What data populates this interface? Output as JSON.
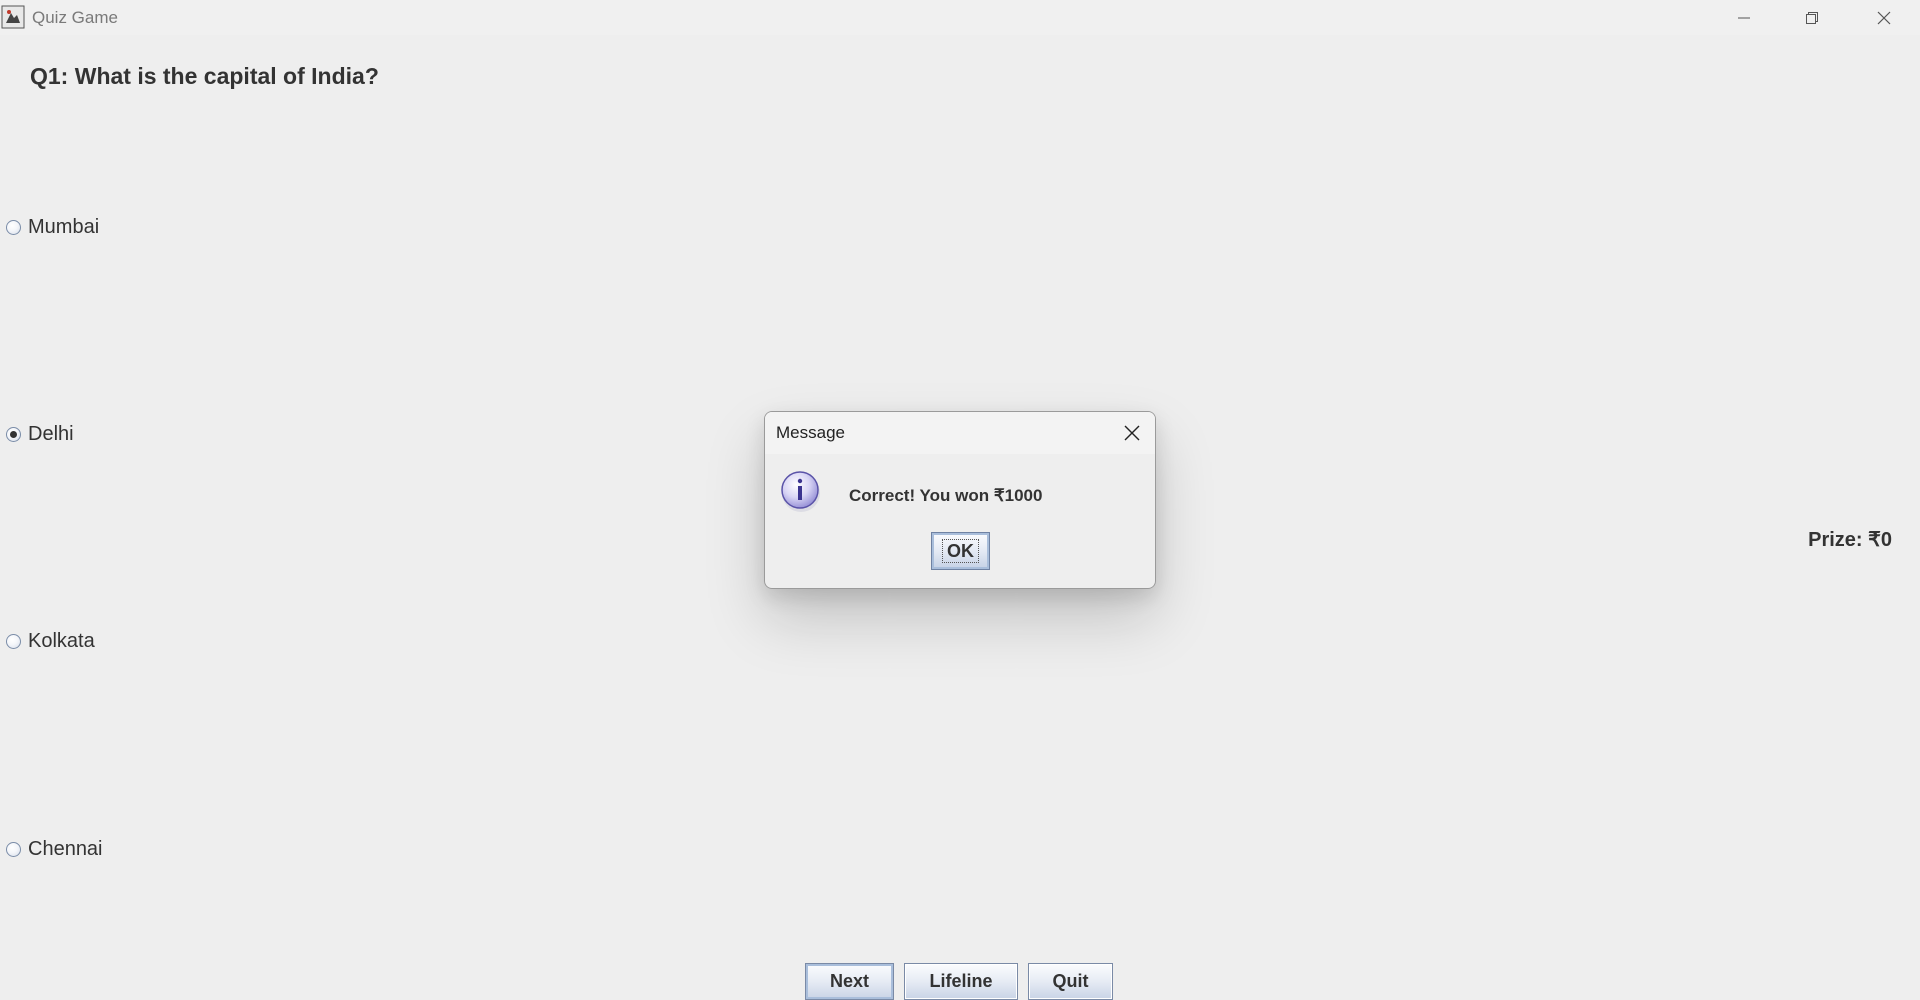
{
  "window": {
    "title": "Quiz Game"
  },
  "quiz": {
    "question": "Q1: What is the capital of India?",
    "options": [
      {
        "label": "Mumbai",
        "selected": false
      },
      {
        "label": "Delhi",
        "selected": true
      },
      {
        "label": "Kolkata",
        "selected": false
      },
      {
        "label": "Chennai",
        "selected": false
      }
    ],
    "prize": "Prize: ₹0"
  },
  "buttons": {
    "next": "Next",
    "lifeline": "Lifeline",
    "quit": "Quit"
  },
  "dialog": {
    "title": "Message",
    "message": "Correct! You won ₹1000",
    "ok_label": "OK",
    "icon": "info-icon"
  },
  "icons": {
    "minimize": "minimize-icon",
    "maximize": "restore-icon",
    "close": "close-icon",
    "app": "java-app-icon"
  },
  "colors": {
    "background": "#eeeeee",
    "text": "#333333",
    "button_border": "#7a8aa6"
  }
}
